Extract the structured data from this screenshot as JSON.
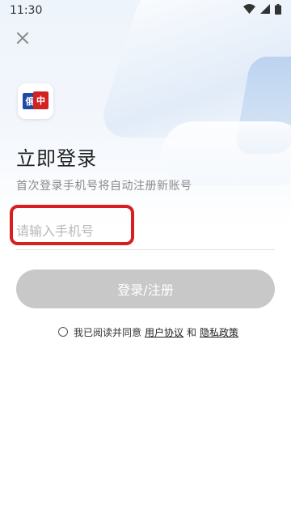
{
  "status_bar": {
    "time": "11:30",
    "icons": [
      "wifi-icon",
      "signal-icon",
      "battery-icon"
    ]
  },
  "header": {
    "close_icon": "close-icon"
  },
  "logo": {
    "left_text": "俄",
    "right_text": "中",
    "colors": {
      "blue": "#1f4aa8",
      "red": "#d32222"
    }
  },
  "main": {
    "title": "立即登录",
    "subtitle": "首次登录手机号将自动注册新账号",
    "phone_input": {
      "value": "",
      "placeholder": "请输入手机号"
    },
    "login_button": "登录/注册"
  },
  "agreement": {
    "prefix": "我已阅读并同意",
    "user_agreement": "用户协议",
    "and": "和",
    "privacy_policy": "隐私政策",
    "checked": false
  },
  "colors": {
    "highlight": "#d81e1e",
    "button_disabled": "#c8c8c8"
  }
}
